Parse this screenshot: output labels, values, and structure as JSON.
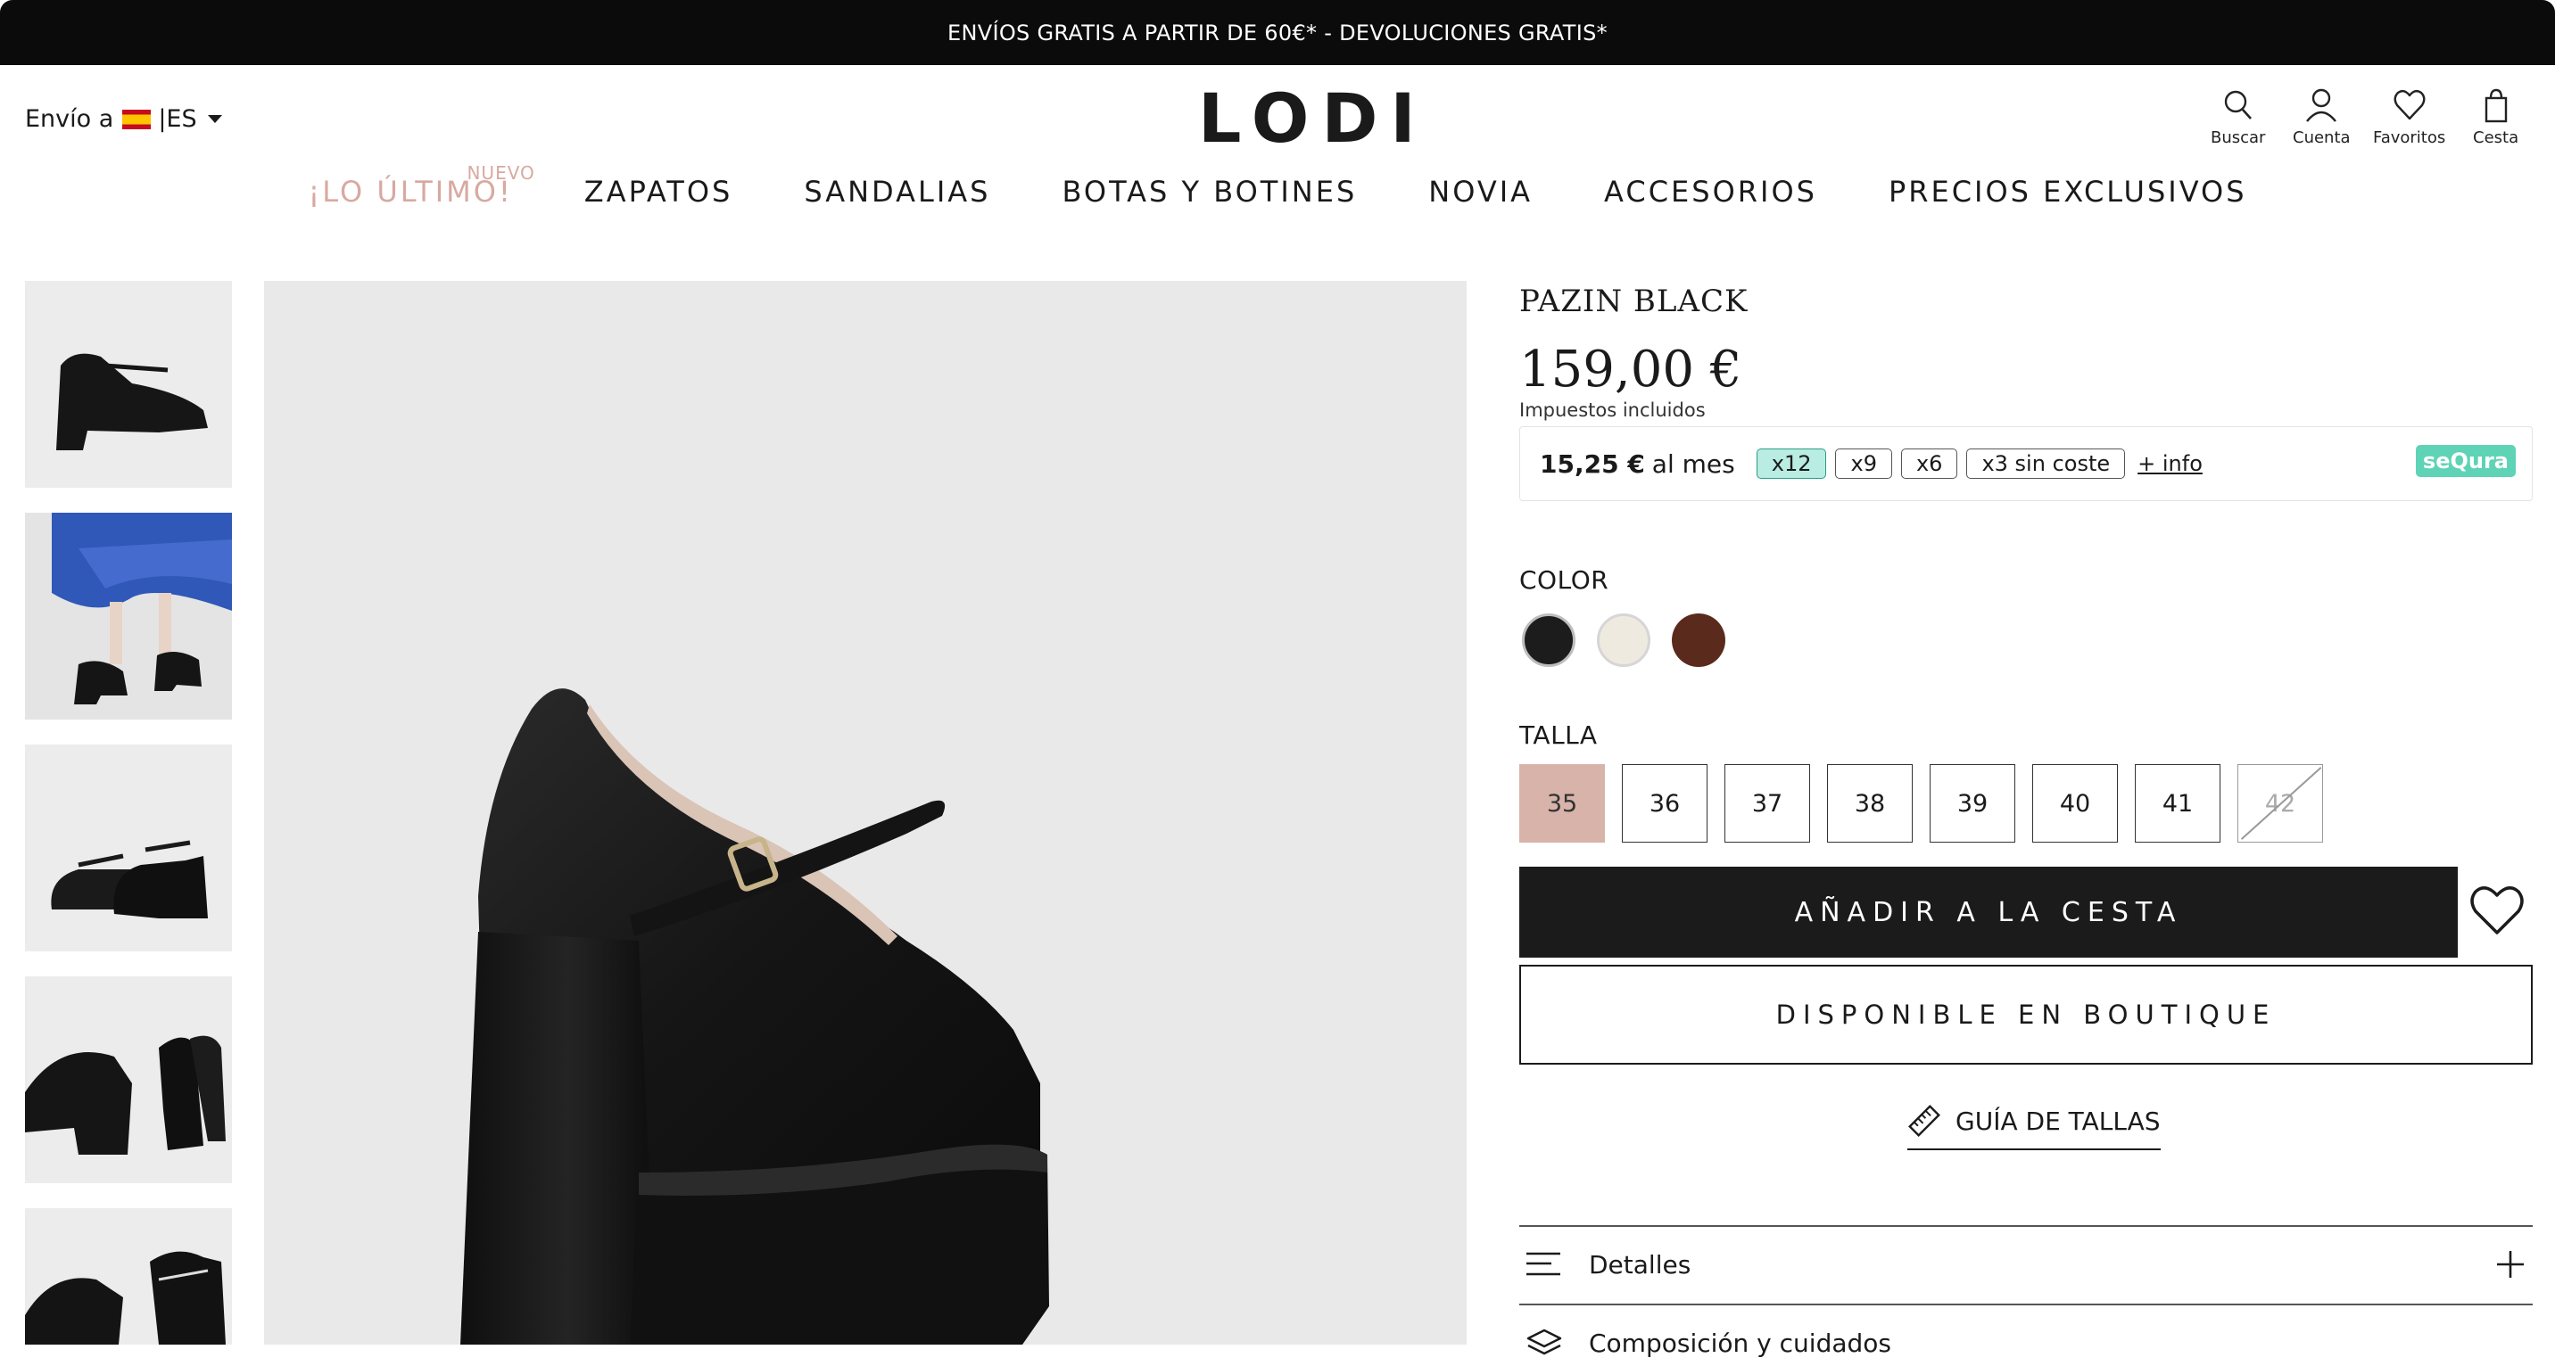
{
  "announcement": "ENVÍOS GRATIS A PARTIR DE 60€* - DEVOLUCIONES GRATIS*",
  "header": {
    "ship_to": "Envío a",
    "country_code": "|ES",
    "logo": "LODI",
    "icons": [
      {
        "name": "search-icon",
        "label": "Buscar"
      },
      {
        "name": "account-icon",
        "label": "Cuenta"
      },
      {
        "name": "heart-icon",
        "label": "Favoritos"
      },
      {
        "name": "bag-icon",
        "label": "Cesta"
      }
    ]
  },
  "nav": {
    "items": [
      "¡LO ÚLTIMO!",
      "ZAPATOS",
      "SANDALIAS",
      "BOTAS Y BOTINES",
      "NOVIA",
      "ACCESORIOS",
      "PRECIOS EXCLUSIVOS"
    ],
    "badge": "NUEVO"
  },
  "product": {
    "title": "PAZIN BLACK",
    "price": "159,00 €",
    "tax_note": "Impuestos incluidos",
    "financing": {
      "amount": "15,25 €",
      "period": "al mes",
      "options": [
        "x12",
        "x9",
        "x6",
        "x3 sin coste"
      ],
      "selected": "x12",
      "more": "+ info",
      "provider": "seQura"
    },
    "color_label": "COLOR",
    "colors": [
      "#1c1c1c",
      "#eeeae0",
      "#5a2a1d"
    ],
    "size_label": "TALLA",
    "sizes": [
      "35",
      "36",
      "37",
      "38",
      "39",
      "40",
      "41",
      "42"
    ],
    "selected_size": "35",
    "unavailable_sizes": [
      "42"
    ],
    "add_to_cart": "AÑADIR A LA CESTA",
    "boutique": "DISPONIBLE EN BOUTIQUE",
    "size_guide": "GUÍA DE TALLAS",
    "accordion": [
      "Detalles",
      "Composición y cuidados"
    ]
  },
  "colors": {
    "accent": "#d8a9a0",
    "sequra": "#5ed3b5",
    "dark": "#1b1b1b"
  }
}
